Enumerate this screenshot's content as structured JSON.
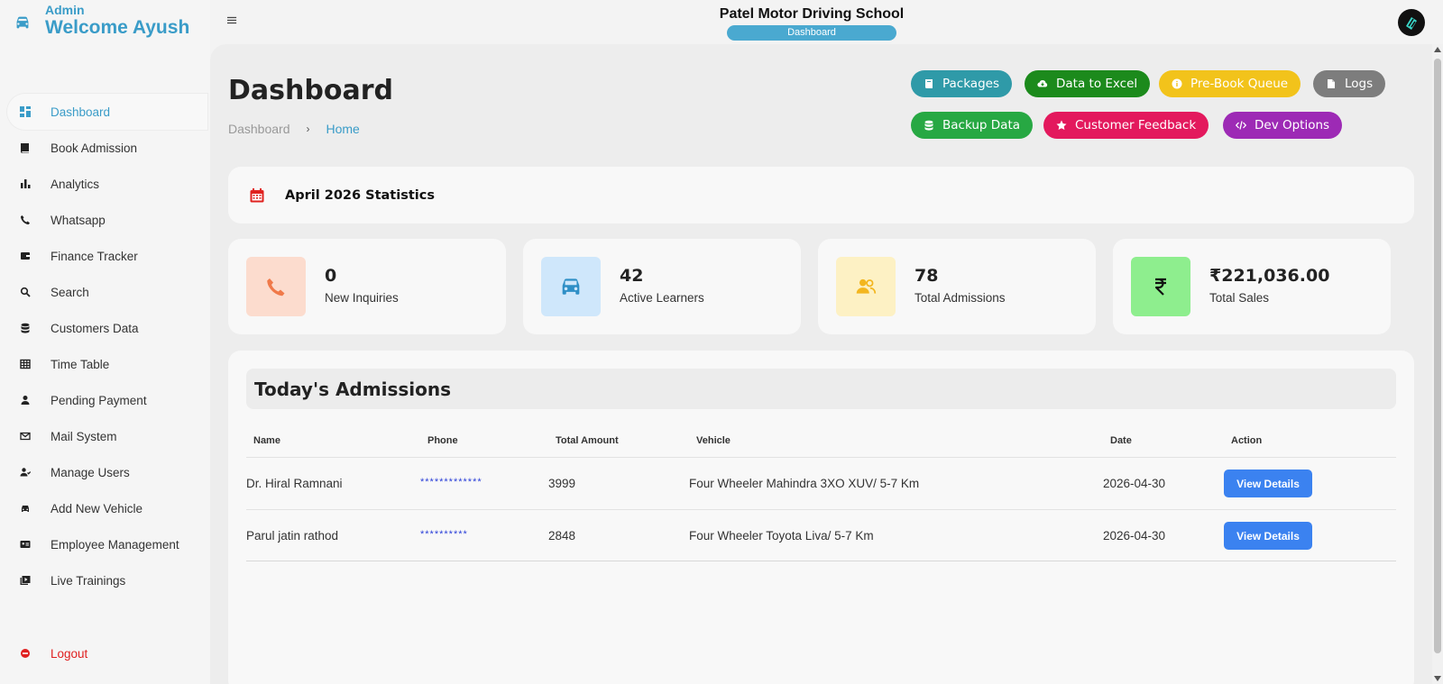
{
  "brand": {
    "role": "Admin",
    "welcome": "Welcome Ayush",
    "icon": "car-icon"
  },
  "sidebar": {
    "items": [
      {
        "label": "Dashboard",
        "icon": "dashboard-icon",
        "active": true
      },
      {
        "label": "Book Admission",
        "icon": "book-icon"
      },
      {
        "label": "Analytics",
        "icon": "bar-chart-icon"
      },
      {
        "label": "Whatsapp",
        "icon": "phone-icon"
      },
      {
        "label": "Finance Tracker",
        "icon": "wallet-icon"
      },
      {
        "label": "Search",
        "icon": "search-icon"
      },
      {
        "label": "Customers Data",
        "icon": "database-icon"
      },
      {
        "label": "Time Table",
        "icon": "table-icon"
      },
      {
        "label": "Pending Payment",
        "icon": "user-icon"
      },
      {
        "label": "Mail System",
        "icon": "mail-icon"
      },
      {
        "label": "Manage Users",
        "icon": "users-icon"
      },
      {
        "label": "Add New Vehicle",
        "icon": "car-icon"
      },
      {
        "label": "Employee Management",
        "icon": "id-card-icon"
      },
      {
        "label": "Live Trainings",
        "icon": "video-icon"
      }
    ],
    "logout": "Logout"
  },
  "header": {
    "school_name": "Patel Motor Driving School",
    "badge": "Dashboard"
  },
  "page": {
    "title": "Dashboard",
    "breadcrumb": [
      "Dashboard",
      "Home"
    ]
  },
  "actions": [
    {
      "label": "Packages",
      "color": "#2f9aa8",
      "icon": "book-icon"
    },
    {
      "label": "Data to Excel",
      "color": "#1c8a1c",
      "icon": "cloud-download-icon"
    },
    {
      "label": "Pre-Book Queue",
      "color": "#f2c31b",
      "icon": "info-icon"
    },
    {
      "label": "Logs",
      "color": "#7d7d7d",
      "icon": "file-icon"
    },
    {
      "label": "Backup Data",
      "color": "#27a843",
      "icon": "database-icon"
    },
    {
      "label": "Customer Feedback",
      "color": "#e3195d",
      "icon": "star-icon"
    },
    {
      "label": "Dev Options",
      "color": "#9d2ab5",
      "icon": "code-icon"
    }
  ],
  "stats_title": "April 2026 Statistics",
  "stats": [
    {
      "value": "0",
      "label": "New Inquiries",
      "icon": "phone-icon",
      "bg": "#fcdcce",
      "fg": "#f07a4a"
    },
    {
      "value": "42",
      "label": "Active Learners",
      "icon": "car-icon",
      "bg": "#cfe7fb",
      "fg": "#2f8fc6"
    },
    {
      "value": "78",
      "label": "Total Admissions",
      "icon": "users-icon",
      "bg": "#fdf1c4",
      "fg": "#f3b61f"
    },
    {
      "value": "₹221,036.00",
      "label": "Total Sales",
      "icon": "rupee-icon",
      "bg": "#8eee8e",
      "fg": "#111111"
    }
  ],
  "admissions": {
    "title": "Today's Admissions",
    "columns": [
      "Name",
      "Phone",
      "Total Amount",
      "Vehicle",
      "Date",
      "Action"
    ],
    "rows": [
      {
        "name": "Dr. Hiral Ramnani",
        "phone": "*************",
        "amount": "3999",
        "vehicle": "Four Wheeler Mahindra 3XO XUV/ 5-7 Km",
        "date": "2026-04-30",
        "action": "View Details"
      },
      {
        "name": "Parul jatin rathod",
        "phone": "**********",
        "amount": "2848",
        "vehicle": "Four Wheeler Toyota Liva/ 5-7 Km",
        "date": "2026-04-30",
        "action": "View Details"
      }
    ]
  }
}
